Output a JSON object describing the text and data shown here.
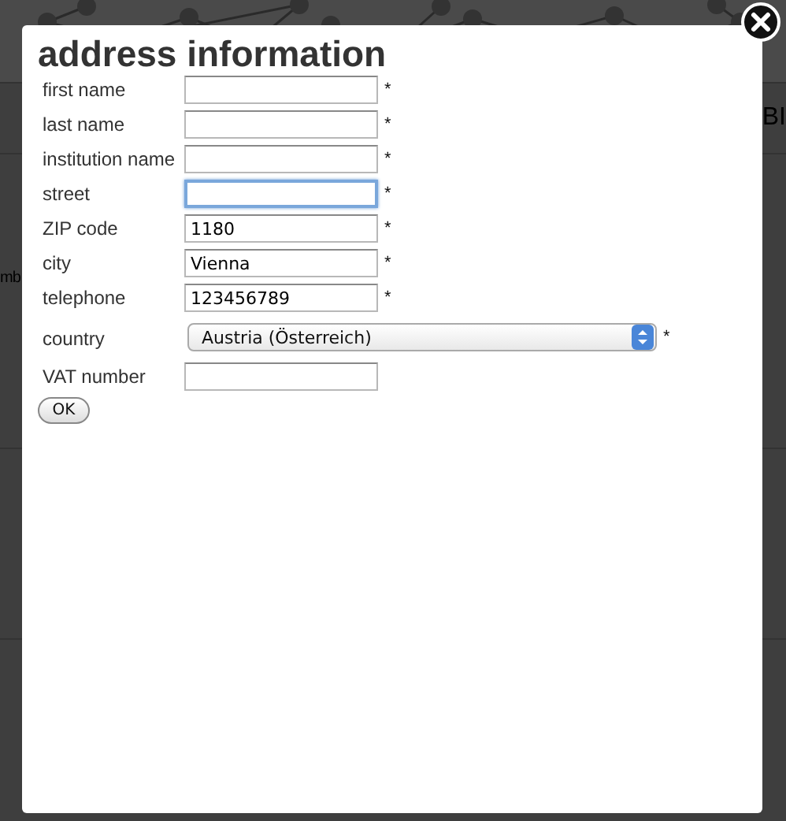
{
  "background": {
    "nav_right": "BI",
    "content_fragment": "mb"
  },
  "dialog": {
    "title": "address information",
    "fields": [
      {
        "kind": "text",
        "label": "first name",
        "focused": false,
        "required_mark": "*"
      },
      {
        "kind": "text",
        "label": "last name",
        "focused": false,
        "required_mark": "*"
      },
      {
        "kind": "text",
        "label": "institution name",
        "focused": false,
        "required_mark": "*"
      },
      {
        "kind": "text",
        "label": "street",
        "focused": true,
        "required_mark": "*"
      },
      {
        "kind": "text",
        "label": "ZIP code",
        "value": "1180",
        "focused": false,
        "required_mark": "*"
      },
      {
        "kind": "text",
        "label": "city",
        "value": "Vienna",
        "focused": false,
        "required_mark": "*"
      },
      {
        "kind": "text",
        "label": "telephone",
        "value": "123456789",
        "focused": false,
        "required_mark": "*"
      },
      {
        "kind": "select",
        "label": "country",
        "value": "Austria (Österreich)",
        "focused": false,
        "required_mark": "*"
      },
      {
        "kind": "text",
        "label": "VAT number",
        "focused": false
      }
    ],
    "button": "OK"
  }
}
